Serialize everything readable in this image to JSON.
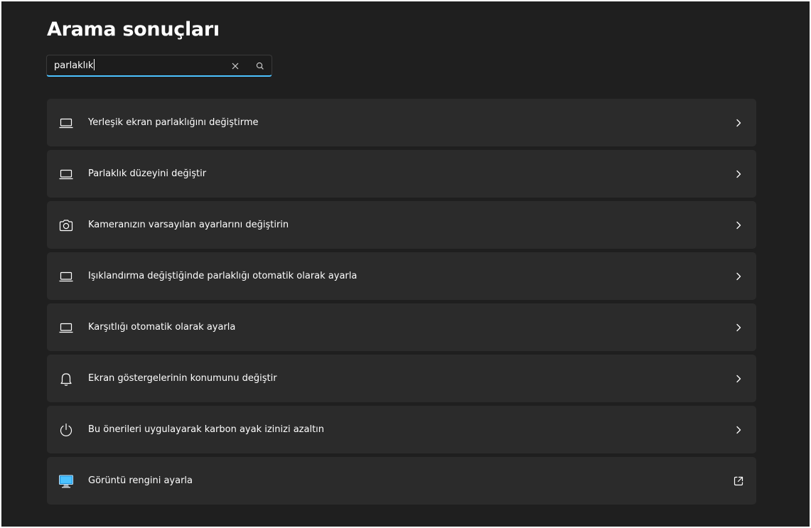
{
  "page": {
    "title": "Arama sonuçları"
  },
  "search": {
    "value": "parlaklık",
    "clear_icon": "close-icon",
    "submit_icon": "search-icon"
  },
  "colors": {
    "background": "#1f1f1f",
    "card": "#2b2b2b",
    "accent": "#4cc2ff",
    "text": "#ffffff"
  },
  "results": [
    {
      "label": "Yerleşik ekran parlaklığını değiştirme",
      "icon": "laptop-icon",
      "action": "chevron-right-icon"
    },
    {
      "label": "Parlaklık düzeyini değiştir",
      "icon": "laptop-icon",
      "action": "chevron-right-icon"
    },
    {
      "label": "Kameranızın varsayılan ayarlarını değiştirin",
      "icon": "camera-icon",
      "action": "chevron-right-icon"
    },
    {
      "label": "Işıklandırma değiştiğinde parlaklığı otomatik olarak ayarla",
      "icon": "laptop-icon",
      "action": "chevron-right-icon"
    },
    {
      "label": "Karşıtlığı otomatik olarak ayarla",
      "icon": "laptop-icon",
      "action": "chevron-right-icon"
    },
    {
      "label": "Ekran göstergelerinin konumunu değiştir",
      "icon": "bell-icon",
      "action": "chevron-right-icon"
    },
    {
      "label": "Bu önerileri uygulayarak karbon ayak izinizi azaltın",
      "icon": "power-icon",
      "action": "chevron-right-icon"
    },
    {
      "label": "Görüntü rengini ayarla",
      "icon": "monitor-color-icon",
      "action": "external-link-icon"
    }
  ]
}
